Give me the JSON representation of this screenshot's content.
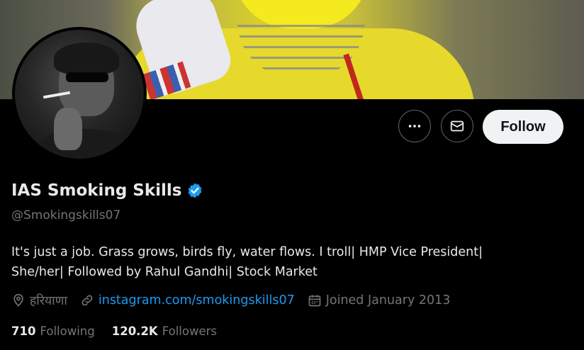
{
  "profile": {
    "display_name": "IAS Smoking Skills",
    "handle": "@Smokingskills07",
    "verified": true,
    "bio_lines": [
      "It's just a job. Grass grows, birds fly, water flows. I troll| HMP Vice President|",
      "She/her| Followed by Rahul Gandhi| Stock Market"
    ],
    "location": "हरियाणा",
    "website": "instagram.com/smokingskills07",
    "joined": "Joined January 2013",
    "following_count": "710",
    "following_label": "Following",
    "followers_count": "120.2K",
    "followers_label": "Followers"
  },
  "actions": {
    "more_icon": "more-icon",
    "message_icon": "message-icon",
    "follow_label": "Follow"
  },
  "colors": {
    "background": "#000000",
    "text_primary": "#e7e9ea",
    "text_secondary": "#71767b",
    "link": "#1d9bf0",
    "verified": "#1d9bf0",
    "follow_bg": "#eff3f4"
  }
}
